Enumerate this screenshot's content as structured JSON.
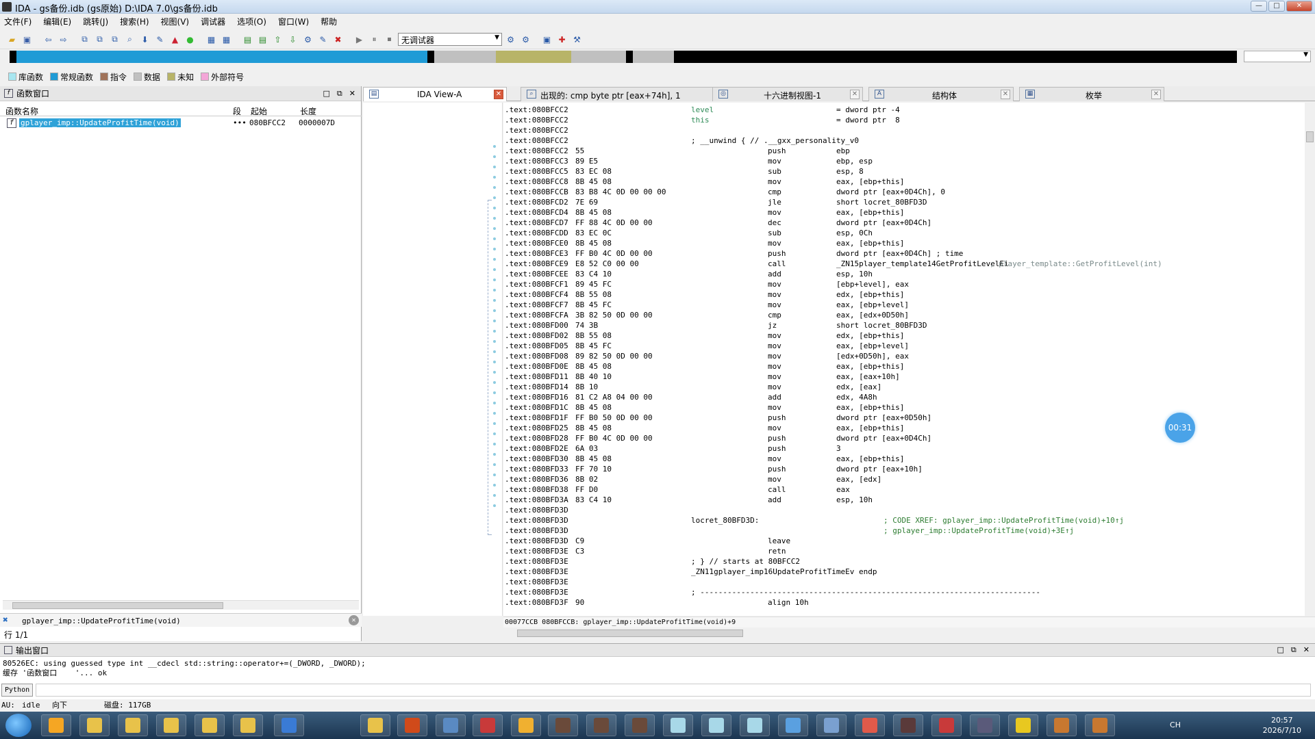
{
  "window": {
    "title": "IDA - gs备份.idb (gs原始) D:\\IDA 7.0\\gs备份.idb",
    "min": "—",
    "max": "□",
    "close": "✕"
  },
  "menu": [
    "文件(F)",
    "编辑(E)",
    "跳转(J)",
    "搜索(H)",
    "视图(V)",
    "调试器",
    "选项(O)",
    "窗口(W)",
    "帮助"
  ],
  "toolbar": {
    "debugger_select": "无调试器"
  },
  "legend": [
    {
      "label": "库函数",
      "color": "#a8e6f0"
    },
    {
      "label": "常规函数",
      "color": "#1f9bd6"
    },
    {
      "label": "指令",
      "color": "#a0735a"
    },
    {
      "label": "数据",
      "color": "#c0c0c0"
    },
    {
      "label": "未知",
      "color": "#b8b468"
    },
    {
      "label": "外部符号",
      "color": "#f4a6d8"
    }
  ],
  "functions_panel": {
    "title": "函数窗口",
    "columns": {
      "name": "函数名称",
      "segment": "段",
      "start": "起始",
      "length": "长度"
    },
    "rows": [
      {
        "name": "gplayer_imp::UpdateProfitTime(void)",
        "segment": "•••",
        "start": "080BFCC2",
        "length": "0000007D"
      }
    ],
    "search_text": "gplayer_imp::UpdateProfitTime(void)",
    "line_count": "行 1/1"
  },
  "tabs": [
    {
      "label": "IDA View-A"
    },
    {
      "label": "出现的: cmp        byte ptr [eax+74h], 1"
    },
    {
      "label": "十六进制视图-1"
    },
    {
      "label": "结构体"
    },
    {
      "label": "枚举"
    }
  ],
  "disasm": [
    {
      "addr": ".text:080BFCC2",
      "bytes": "",
      "label": "level",
      "mn": "",
      "op": "= dword ptr -4",
      "cmt": ""
    },
    {
      "addr": ".text:080BFCC2",
      "bytes": "",
      "label": "this",
      "mn": "",
      "op": "= dword ptr  8",
      "cmt": ""
    },
    {
      "addr": ".text:080BFCC2",
      "bytes": "",
      "label": "",
      "mn": "",
      "op": "",
      "cmt": ""
    },
    {
      "addr": ".text:080BFCC2",
      "bytes": "",
      "label": "; __unwind { // .__gxx_personality_v0",
      "mn": "",
      "op": "",
      "cmt": ""
    },
    {
      "addr": ".text:080BFCC2",
      "bytes": "55",
      "label": "",
      "mn": "push",
      "op": "ebp",
      "cmt": ""
    },
    {
      "addr": ".text:080BFCC3",
      "bytes": "89 E5",
      "label": "",
      "mn": "mov",
      "op": "ebp, esp",
      "cmt": ""
    },
    {
      "addr": ".text:080BFCC5",
      "bytes": "83 EC 08",
      "label": "",
      "mn": "sub",
      "op": "esp, 8",
      "cmt": ""
    },
    {
      "addr": ".text:080BFCC8",
      "bytes": "8B 45 08",
      "label": "",
      "mn": "mov",
      "op": "eax, [ebp+this]",
      "cmt": ""
    },
    {
      "addr": ".text:080BFCCB",
      "bytes": "83 B8 4C 0D 00 00 00",
      "label": "",
      "mn": "cmp",
      "op": "dword ptr [eax+0D4Ch], 0",
      "cmt": ""
    },
    {
      "addr": ".text:080BFCD2",
      "bytes": "7E 69",
      "label": "",
      "mn": "jle",
      "op": "short locret_80BFD3D",
      "cmt": ""
    },
    {
      "addr": ".text:080BFCD4",
      "bytes": "8B 45 08",
      "label": "",
      "mn": "mov",
      "op": "eax, [ebp+this]",
      "cmt": ""
    },
    {
      "addr": ".text:080BFCD7",
      "bytes": "FF 88 4C 0D 00 00",
      "label": "",
      "mn": "dec",
      "op": "dword ptr [eax+0D4Ch]",
      "cmt": ""
    },
    {
      "addr": ".text:080BFCDD",
      "bytes": "83 EC 0C",
      "label": "",
      "mn": "sub",
      "op": "esp, 0Ch",
      "cmt": ""
    },
    {
      "addr": ".text:080BFCE0",
      "bytes": "8B 45 08",
      "label": "",
      "mn": "mov",
      "op": "eax, [ebp+this]",
      "cmt": ""
    },
    {
      "addr": ".text:080BFCE3",
      "bytes": "FF B0 4C 0D 00 00",
      "label": "",
      "mn": "push",
      "op": "dword ptr [eax+0D4Ch] ; time",
      "cmt": ""
    },
    {
      "addr": ".text:080BFCE9",
      "bytes": "E8 52 C0 00 00",
      "label": "",
      "mn": "call",
      "op": "_ZN15player_template14GetProfitLevelEi",
      "cmt": "; player_template::GetProfitLevel(int)"
    },
    {
      "addr": ".text:080BFCEE",
      "bytes": "83 C4 10",
      "label": "",
      "mn": "add",
      "op": "esp, 10h",
      "cmt": ""
    },
    {
      "addr": ".text:080BFCF1",
      "bytes": "89 45 FC",
      "label": "",
      "mn": "mov",
      "op": "[ebp+level], eax",
      "cmt": ""
    },
    {
      "addr": ".text:080BFCF4",
      "bytes": "8B 55 08",
      "label": "",
      "mn": "mov",
      "op": "edx, [ebp+this]",
      "cmt": ""
    },
    {
      "addr": ".text:080BFCF7",
      "bytes": "8B 45 FC",
      "label": "",
      "mn": "mov",
      "op": "eax, [ebp+level]",
      "cmt": ""
    },
    {
      "addr": ".text:080BFCFA",
      "bytes": "3B 82 50 0D 00 00",
      "label": "",
      "mn": "cmp",
      "op": "eax, [edx+0D50h]",
      "cmt": ""
    },
    {
      "addr": ".text:080BFD00",
      "bytes": "74 3B",
      "label": "",
      "mn": "jz",
      "op": "short locret_80BFD3D",
      "cmt": ""
    },
    {
      "addr": ".text:080BFD02",
      "bytes": "8B 55 08",
      "label": "",
      "mn": "mov",
      "op": "edx, [ebp+this]",
      "cmt": ""
    },
    {
      "addr": ".text:080BFD05",
      "bytes": "8B 45 FC",
      "label": "",
      "mn": "mov",
      "op": "eax, [ebp+level]",
      "cmt": ""
    },
    {
      "addr": ".text:080BFD08",
      "bytes": "89 82 50 0D 00 00",
      "label": "",
      "mn": "mov",
      "op": "[edx+0D50h], eax",
      "cmt": ""
    },
    {
      "addr": ".text:080BFD0E",
      "bytes": "8B 45 08",
      "label": "",
      "mn": "mov",
      "op": "eax, [ebp+this]",
      "cmt": ""
    },
    {
      "addr": ".text:080BFD11",
      "bytes": "8B 40 10",
      "label": "",
      "mn": "mov",
      "op": "eax, [eax+10h]",
      "cmt": ""
    },
    {
      "addr": ".text:080BFD14",
      "bytes": "8B 10",
      "label": "",
      "mn": "mov",
      "op": "edx, [eax]",
      "cmt": ""
    },
    {
      "addr": ".text:080BFD16",
      "bytes": "81 C2 A8 04 00 00",
      "label": "",
      "mn": "add",
      "op": "edx, 4A8h",
      "cmt": ""
    },
    {
      "addr": ".text:080BFD1C",
      "bytes": "8B 45 08",
      "label": "",
      "mn": "mov",
      "op": "eax, [ebp+this]",
      "cmt": ""
    },
    {
      "addr": ".text:080BFD1F",
      "bytes": "FF B0 50 0D 00 00",
      "label": "",
      "mn": "push",
      "op": "dword ptr [eax+0D50h]",
      "cmt": ""
    },
    {
      "addr": ".text:080BFD25",
      "bytes": "8B 45 08",
      "label": "",
      "mn": "mov",
      "op": "eax, [ebp+this]",
      "cmt": ""
    },
    {
      "addr": ".text:080BFD28",
      "bytes": "FF B0 4C 0D 00 00",
      "label": "",
      "mn": "push",
      "op": "dword ptr [eax+0D4Ch]",
      "cmt": ""
    },
    {
      "addr": ".text:080BFD2E",
      "bytes": "6A 03",
      "label": "",
      "mn": "push",
      "op": "3",
      "cmt": ""
    },
    {
      "addr": ".text:080BFD30",
      "bytes": "8B 45 08",
      "label": "",
      "mn": "mov",
      "op": "eax, [ebp+this]",
      "cmt": ""
    },
    {
      "addr": ".text:080BFD33",
      "bytes": "FF 70 10",
      "label": "",
      "mn": "push",
      "op": "dword ptr [eax+10h]",
      "cmt": ""
    },
    {
      "addr": ".text:080BFD36",
      "bytes": "8B 02",
      "label": "",
      "mn": "mov",
      "op": "eax, [edx]",
      "cmt": ""
    },
    {
      "addr": ".text:080BFD38",
      "bytes": "FF D0",
      "label": "",
      "mn": "call",
      "op": "eax",
      "cmt": ""
    },
    {
      "addr": ".text:080BFD3A",
      "bytes": "83 C4 10",
      "label": "",
      "mn": "add",
      "op": "esp, 10h",
      "cmt": ""
    },
    {
      "addr": ".text:080BFD3D",
      "bytes": "",
      "label": "",
      "mn": "",
      "op": "",
      "cmt": ""
    },
    {
      "addr": ".text:080BFD3D",
      "bytes": "",
      "label": "locret_80BFD3D:",
      "mn": "",
      "op": "",
      "cmt": "; CODE XREF: gplayer_imp::UpdateProfitTime(void)+10↑j"
    },
    {
      "addr": ".text:080BFD3D",
      "bytes": "",
      "label": "",
      "mn": "",
      "op": "",
      "cmt": "; gplayer_imp::UpdateProfitTime(void)+3E↑j"
    },
    {
      "addr": ".text:080BFD3D",
      "bytes": "C9",
      "label": "",
      "mn": "leave",
      "op": "",
      "cmt": ""
    },
    {
      "addr": ".text:080BFD3E",
      "bytes": "C3",
      "label": "",
      "mn": "retn",
      "op": "",
      "cmt": ""
    },
    {
      "addr": ".text:080BFD3E",
      "bytes": "",
      "label": "; } // starts at 80BFCC2",
      "mn": "",
      "op": "",
      "cmt": ""
    },
    {
      "addr": ".text:080BFD3E",
      "bytes": "",
      "label": "_ZN11gplayer_imp16UpdateProfitTimeEv endp",
      "mn": "",
      "op": "",
      "cmt": ""
    },
    {
      "addr": ".text:080BFD3E",
      "bytes": "",
      "label": "",
      "mn": "",
      "op": "",
      "cmt": ""
    },
    {
      "addr": ".text:080BFD3E",
      "bytes": "",
      "label": "; ---------------------------------------------------------------------------",
      "mn": "",
      "op": "",
      "cmt": ""
    },
    {
      "addr": ".text:080BFD3F",
      "bytes": "90",
      "label": "",
      "mn": "align 10h",
      "op": "",
      "cmt": ""
    }
  ],
  "disasm_status": "00077CCB 080BFCCB: gplayer_imp::UpdateProfitTime(void)+9",
  "timer": "00:31",
  "output_panel": {
    "title": "输出窗口",
    "lines": "80526EC: using guessed type int __cdecl std::string::operator+=(_DWORD, _DWORD);\n缓存 '函数窗口    '... ok",
    "python_button": "Python"
  },
  "statusbar": {
    "au": "AU:",
    "state": "idle",
    "direction": "向下",
    "disk": "磁盘: 117GB"
  },
  "tray": {
    "lang": "CH",
    "time": "20:57",
    "date": "2026/7/10"
  },
  "colors": {
    "accent": "#1f9bd6",
    "selection": "#2fa2d8",
    "code_green": "#2e8b57"
  }
}
